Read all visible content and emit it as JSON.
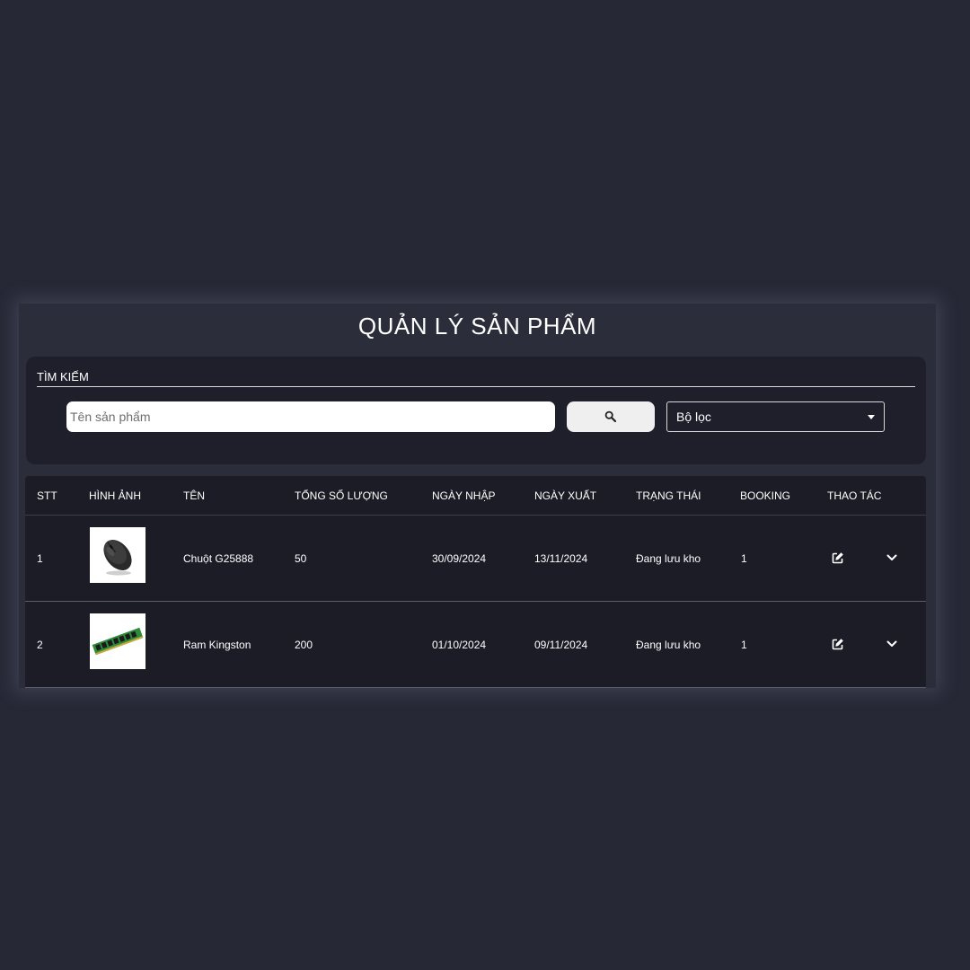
{
  "page": {
    "title": "QUẢN LÝ SẢN PHẨM"
  },
  "search": {
    "label": "TÌM KIẾM",
    "placeholder": "Tên sản phẩm",
    "value": "",
    "button_icon": "search-icon",
    "filter_value": "Bộ lọc"
  },
  "table": {
    "headers": [
      "STT",
      "HÌNH ẢNH",
      "TÊN",
      "TỔNG SỐ LƯỢNG",
      "NGÀY NHẬP",
      "NGÀY XUẤT",
      "TRẠNG THÁI",
      "BOOKING",
      "THAO TÁC"
    ],
    "rows": [
      {
        "stt": "1",
        "image": "mouse-image",
        "name": "Chuột G25888",
        "quantity": "50",
        "import_date": "30/09/2024",
        "export_date": "13/11/2024",
        "status": "Đang lưu kho",
        "booking": "1",
        "actions": [
          "edit-icon",
          "chevron-down-icon"
        ]
      },
      {
        "stt": "2",
        "image": "ram-image",
        "name": "Ram Kingston",
        "quantity": "200",
        "import_date": "01/10/2024",
        "export_date": "09/11/2024",
        "status": "Đang lưu kho",
        "booking": "1",
        "actions": [
          "edit-icon",
          "chevron-down-icon"
        ]
      }
    ]
  },
  "colors": {
    "background": "#262836",
    "panel": "#2b2d3a",
    "card": "#1e1f2a",
    "table": "#1c1c26",
    "ram_pcb": "#2e8b3a"
  }
}
